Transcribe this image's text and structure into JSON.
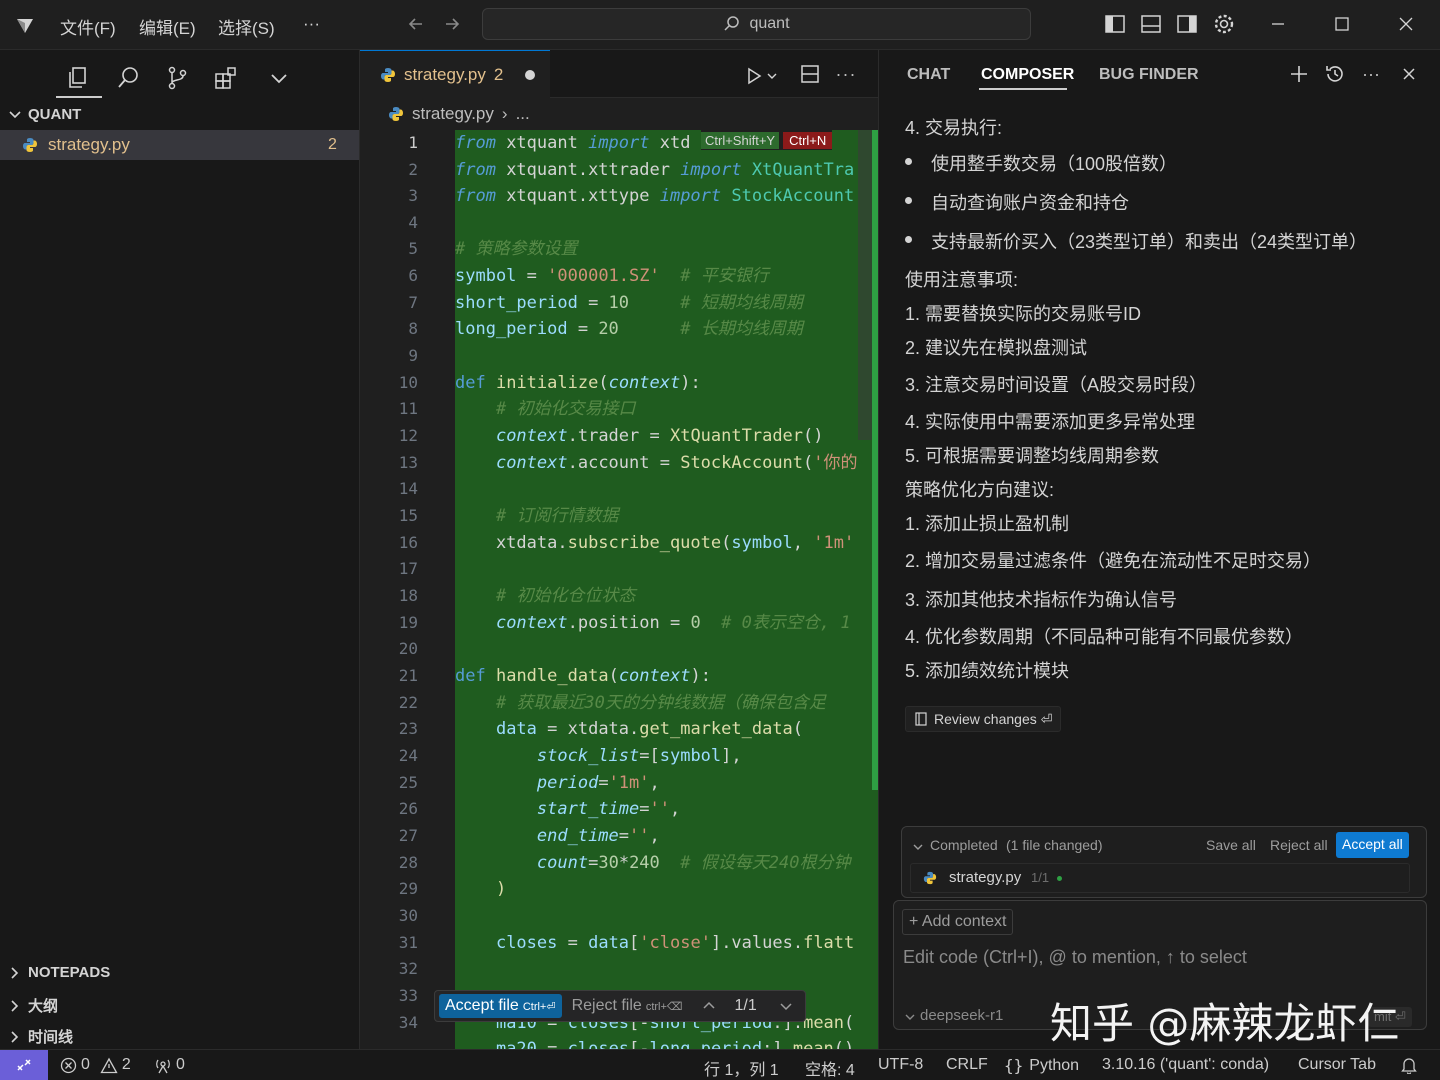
{
  "titlebar": {
    "menus": [
      "文件(F)",
      "编辑(E)",
      "选择(S)",
      "···"
    ],
    "search_text": "quant"
  },
  "sidebar": {
    "workspace": "QUANT",
    "file": {
      "name": "strategy.py",
      "badge": "2"
    },
    "bottom_sections": [
      "NOTEPADS",
      "大纲",
      "时间线"
    ]
  },
  "editor": {
    "tab": {
      "name": "strategy.py",
      "badge": "2"
    },
    "breadcrumb": {
      "file": "strategy.py",
      "rest": "..."
    },
    "inline_hint": {
      "shortcut1": "Ctrl+Shift+Y",
      "shortcut2": "Ctrl+N"
    },
    "line_numbers": [
      "1",
      "2",
      "3",
      "4",
      "5",
      "6",
      "7",
      "8",
      "9",
      "10",
      "11",
      "12",
      "13",
      "14",
      "15",
      "16",
      "17",
      "18",
      "19",
      "20",
      "21",
      "22",
      "23",
      "24",
      "25",
      "26",
      "27",
      "28",
      "29",
      "30",
      "31",
      "32",
      "33",
      "34"
    ],
    "accept_bar": {
      "accept_label": "Accept file",
      "accept_key": "Ctrl+⏎",
      "reject_label": "Reject file",
      "reject_key": "ctrl+⌫",
      "counter": "1/1"
    }
  },
  "panel": {
    "tabs": [
      "CHAT",
      "COMPOSER",
      "BUG FINDER"
    ],
    "active_tab": "COMPOSER",
    "lines": [
      "4. 交易执行:",
      "使用整手数交易（100股倍数）",
      "自动查询账户资金和持仓",
      "支持最新价买入（23类型订单）和卖出（24类型订单）",
      "使用注意事项:",
      "1. 需要替换实际的交易账号ID",
      "2. 建议先在模拟盘测试",
      "3. 注意交易时间设置（A股交易时段）",
      "4. 实际使用中需要添加更多异常处理",
      "5. 可根据需要调整均线周期参数",
      "策略优化方向建议:",
      "1. 添加止损止盈机制",
      "2. 增加交易量过滤条件（避免在流动性不足时交易）",
      "3. 添加其他技术指标作为确认信号",
      "4. 优化参数周期（不同品种可能有不同最优参数）",
      "5. 添加绩效统计模块"
    ],
    "review_label": "Review changes ⏎",
    "completed": {
      "label": "Completed",
      "detail": "(1 file changed)",
      "save_all": "Save all",
      "reject_all": "Reject all",
      "accept_all": "Accept all",
      "file": "strategy.py",
      "count": "1/1"
    },
    "composer": {
      "add_context": "+ Add context",
      "placeholder": "Edit code (Ctrl+I), @ to mention, ↑ to select",
      "model": "deepseek-r1",
      "submit": "mit ⏎"
    }
  },
  "statusbar": {
    "errors": "0",
    "warnings": "2",
    "ports": "0",
    "position": "行 1，列 1",
    "spaces": "空格: 4",
    "encoding": "UTF-8",
    "eol": "CRLF",
    "language": "Python",
    "interpreter": "3.10.16 ('quant': conda)",
    "cursor_tab": "Cursor Tab"
  },
  "watermark": "知乎 @麻辣龙虾仁"
}
